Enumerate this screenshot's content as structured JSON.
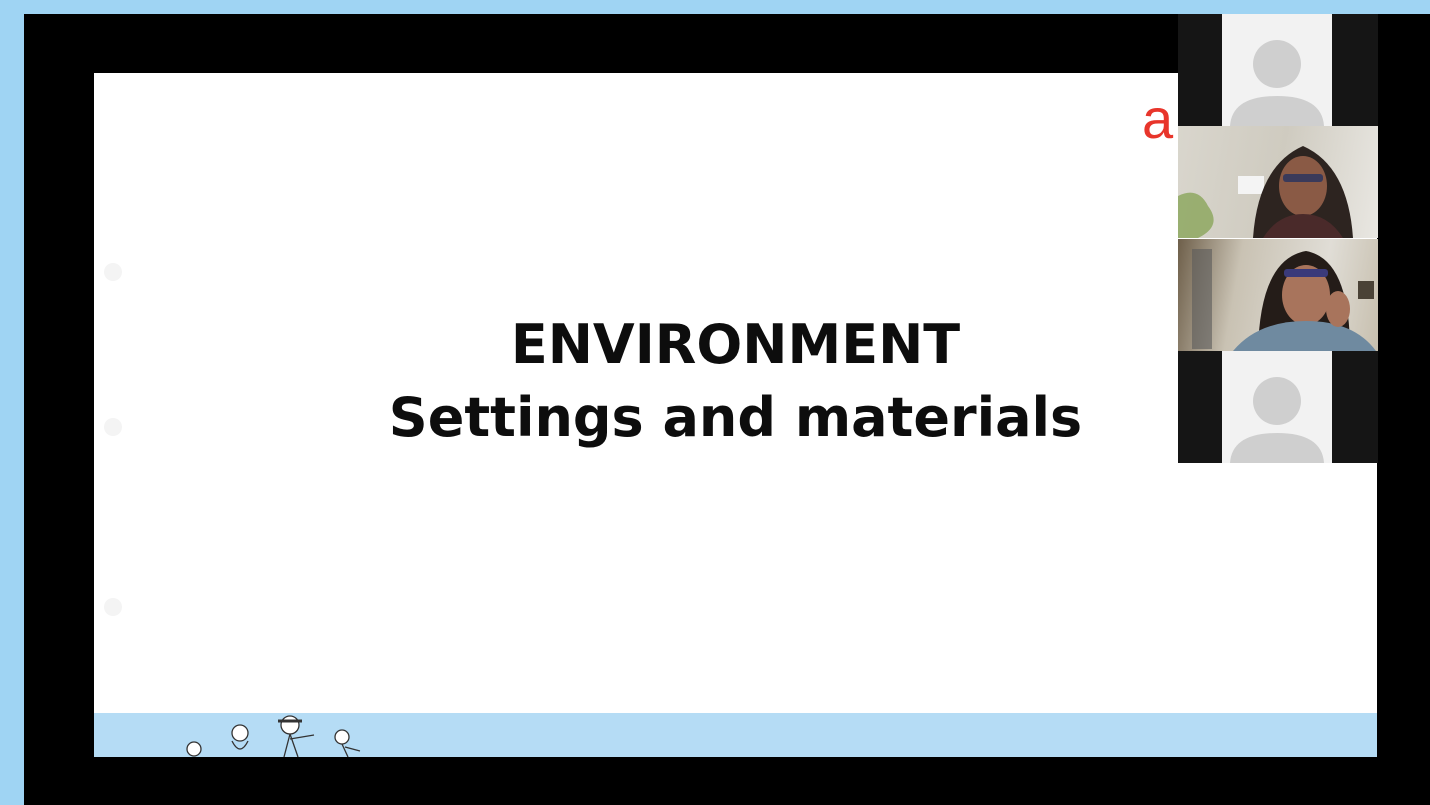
{
  "slide": {
    "title_line1": "ENVIRONMENT",
    "title_line2": "Settings and materials",
    "brand_letter": "a"
  },
  "participants": [
    {
      "type": "avatar-placeholder"
    },
    {
      "type": "video"
    },
    {
      "type": "video"
    },
    {
      "type": "avatar-placeholder"
    }
  ],
  "colors": {
    "page_bg": "#9fd4f3",
    "stage_bg": "#000000",
    "slide_bg": "#ffffff",
    "brand_red": "#e8352b",
    "footer_band": "#b5dcf5"
  }
}
